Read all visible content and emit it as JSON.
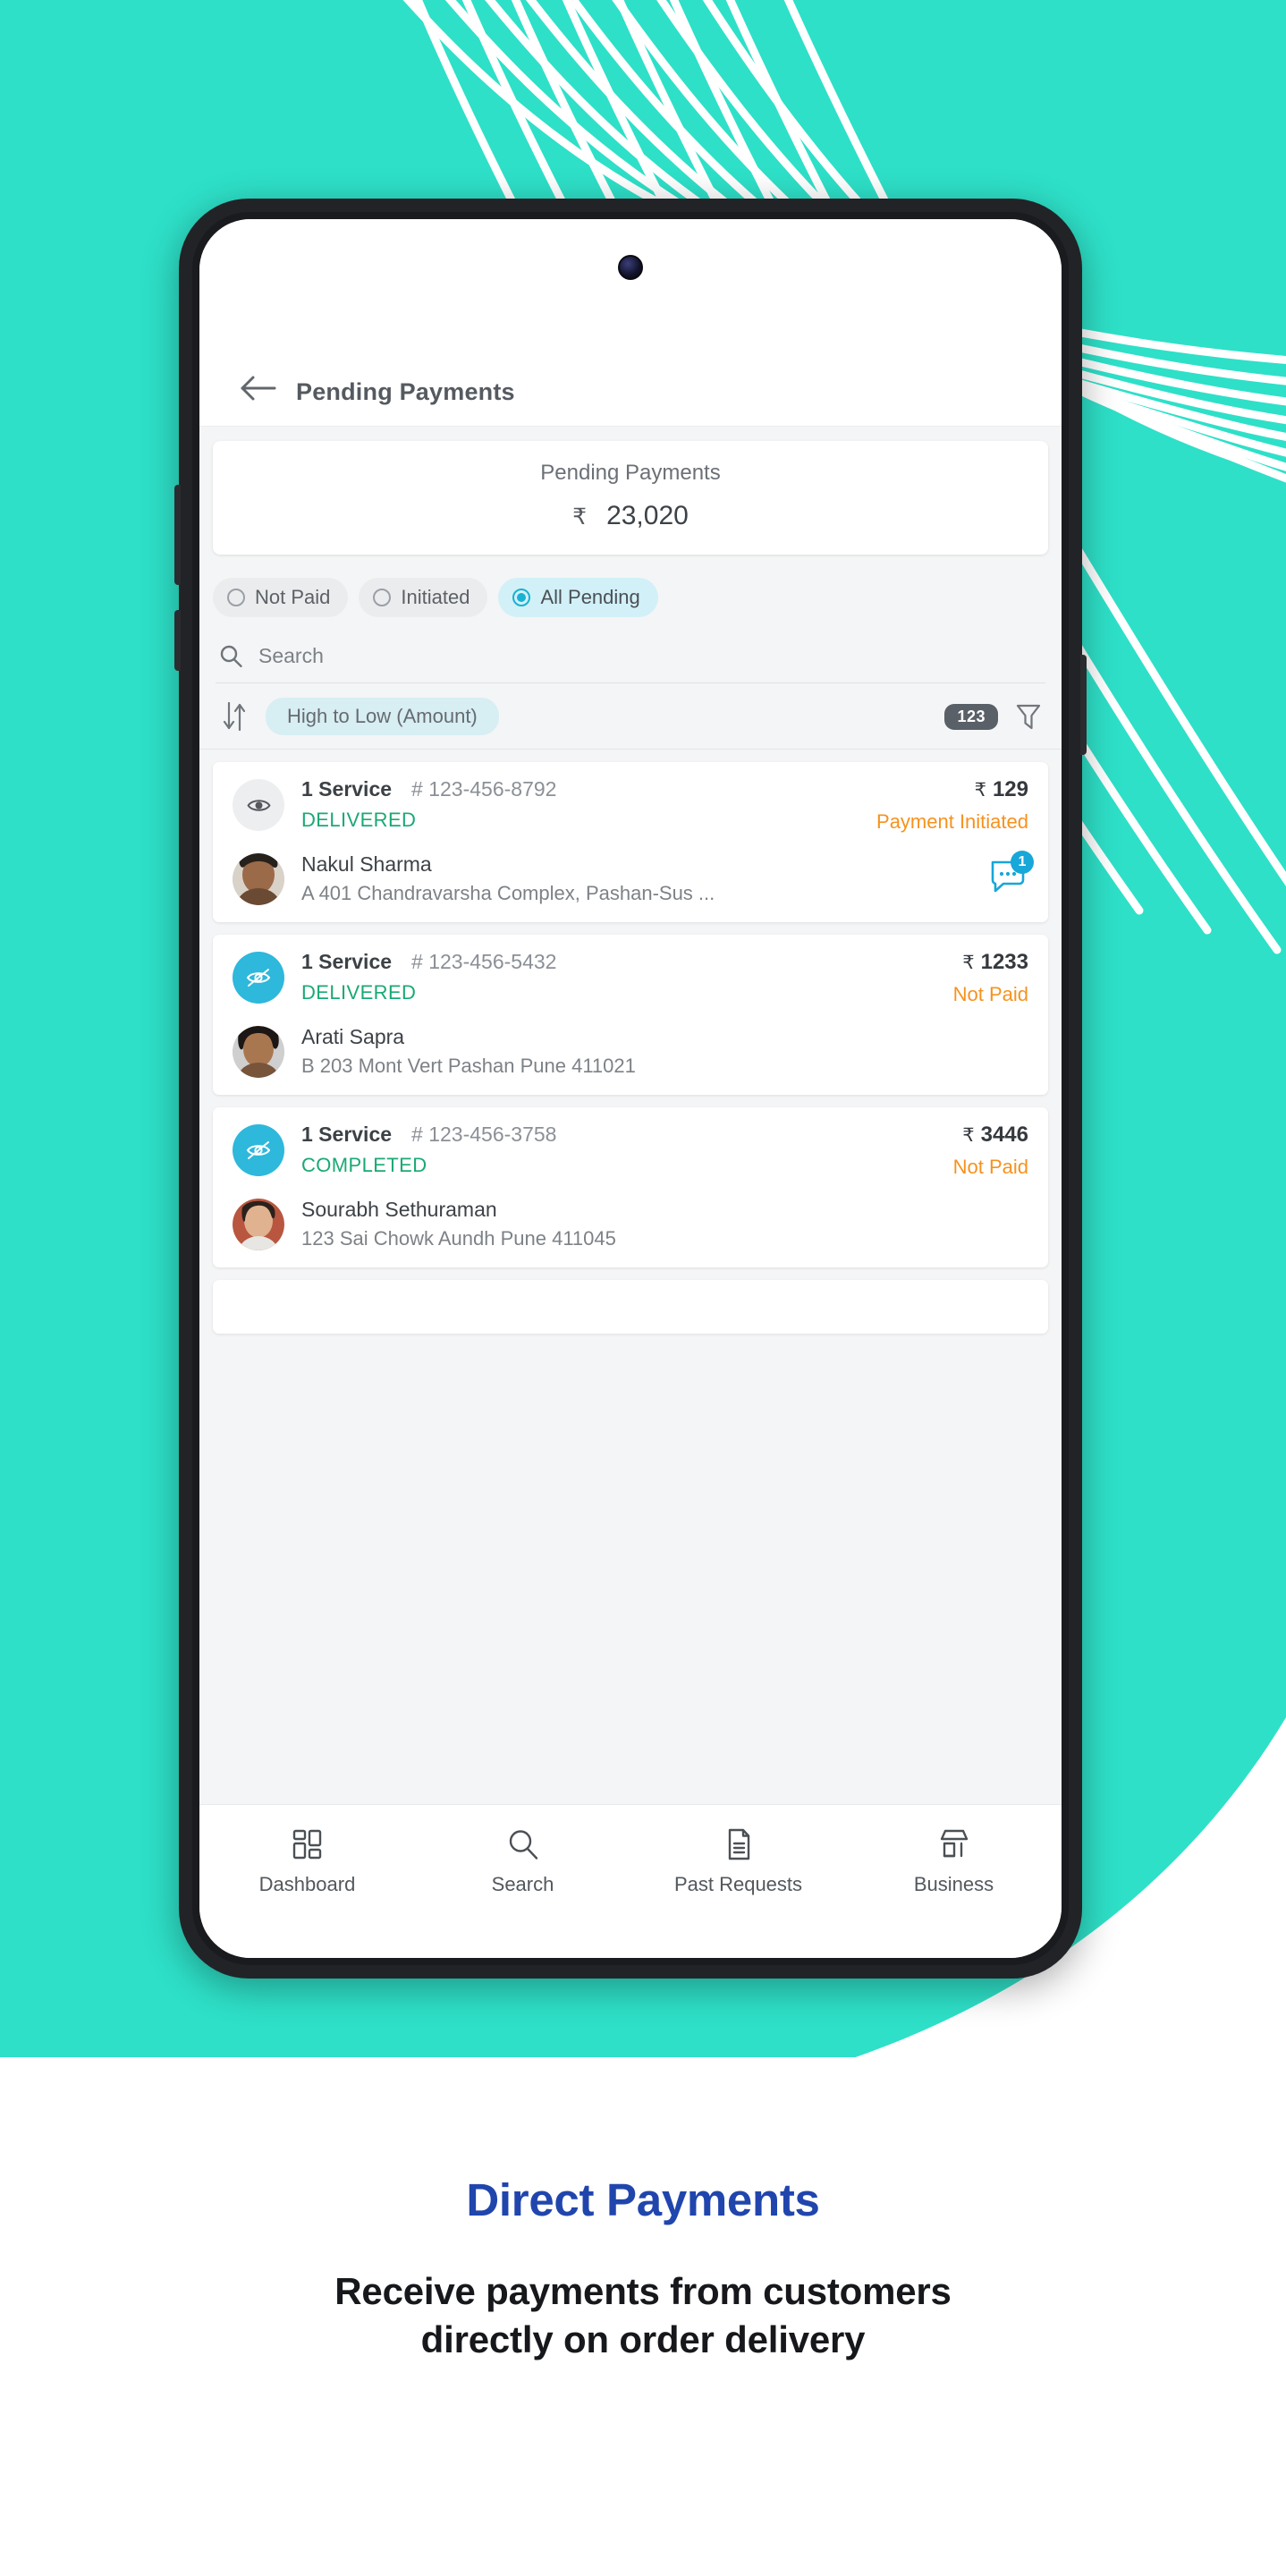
{
  "background": {
    "teal_color": "#2ee0c8",
    "line_color": "#ffffff"
  },
  "app": {
    "header": {
      "back_icon": "arrow-left-icon",
      "title": "Pending Payments"
    },
    "summary": {
      "label": "Pending Payments",
      "currency": "₹",
      "amount": "23,020"
    },
    "filter_chips": [
      {
        "label": "Not Paid",
        "selected": false
      },
      {
        "label": "Initiated",
        "selected": false
      },
      {
        "label": "All Pending",
        "selected": true
      }
    ],
    "search": {
      "icon": "search-icon",
      "placeholder": "Search",
      "value": ""
    },
    "sortbar": {
      "sort_icon": "sort-arrows-icon",
      "sort_label": "High to Low (Amount)",
      "count_badge": "123",
      "filter_icon": "funnel-icon"
    },
    "payments": [
      {
        "visibility_icon": "eye-icon",
        "visibility_state": "visible",
        "service_count": "1 Service",
        "order_id": "# 123-456-8792",
        "order_status": "DELIVERED",
        "currency": "₹",
        "amount": "129",
        "payment_status": "Payment Initiated",
        "payment_status_color": "#f6921e",
        "customer_name": "Nakul Sharma",
        "customer_address": "A 401 Chandravarsha Complex, Pashan-Sus ...",
        "chat_icon": "chat-bubble-icon",
        "chat_badge": "1",
        "avatar": "customer-avatar"
      },
      {
        "visibility_icon": "eye-off-icon",
        "visibility_state": "hidden",
        "service_count": "1 Service",
        "order_id": "# 123-456-5432",
        "order_status": "DELIVERED",
        "currency": "₹",
        "amount": "1233",
        "payment_status": "Not Paid",
        "payment_status_color": "#f6921e",
        "customer_name": "Arati Sapra",
        "customer_address": "B 203 Mont Vert Pashan Pune 411021",
        "chat_icon": "",
        "chat_badge": "",
        "avatar": "customer-avatar"
      },
      {
        "visibility_icon": "eye-off-icon",
        "visibility_state": "hidden",
        "service_count": "1 Service",
        "order_id": "# 123-456-3758",
        "order_status": "COMPLETED",
        "currency": "₹",
        "amount": "3446",
        "payment_status": "Not Paid",
        "payment_status_color": "#f6921e",
        "customer_name": "Sourabh Sethuraman",
        "customer_address": "123 Sai Chowk Aundh Pune 411045",
        "chat_icon": "",
        "chat_badge": "",
        "avatar": "customer-avatar"
      }
    ],
    "bottom_nav": [
      {
        "icon": "dashboard-grid-icon",
        "label": "Dashboard"
      },
      {
        "icon": "search-icon",
        "label": "Search"
      },
      {
        "icon": "document-icon",
        "label": "Past Requests"
      },
      {
        "icon": "storefront-icon",
        "label": "Business"
      }
    ]
  },
  "marketing": {
    "title": "Direct Payments",
    "title_color": "#2046ad",
    "subtitle_line1": "Receive payments from customers",
    "subtitle_line2": "directly on order delivery"
  }
}
